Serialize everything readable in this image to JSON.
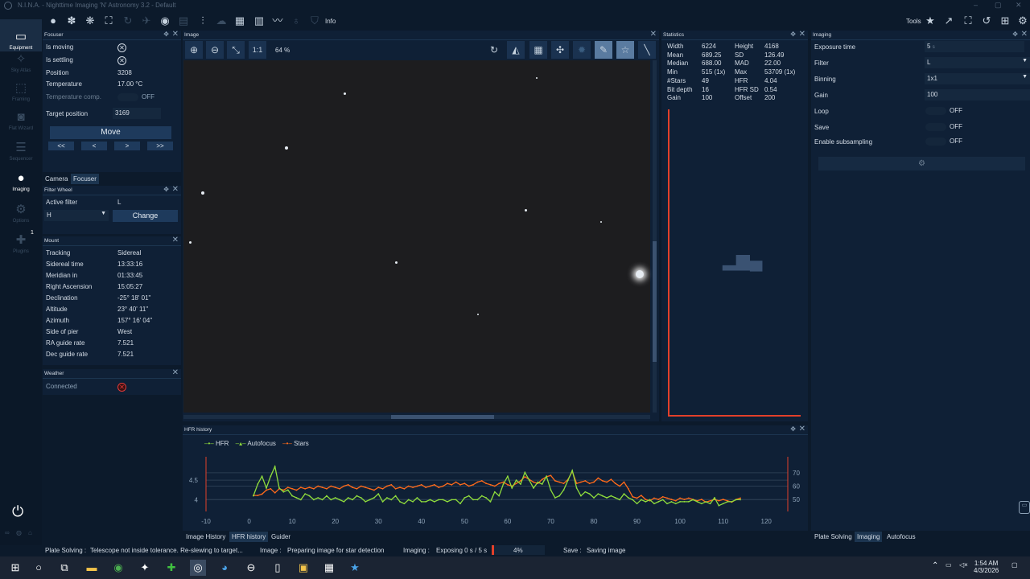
{
  "window": {
    "title": "N.I.N.A. - Nighttime Imaging 'N' Astronomy 3.2  -  Default"
  },
  "toolbar": {
    "info_label": "Info",
    "tools_label": "Tools"
  },
  "sidebar": {
    "items": [
      {
        "label": "Equipment",
        "icon": "equipment-icon"
      },
      {
        "label": "Sky Atlas",
        "icon": "sky-atlas-icon"
      },
      {
        "label": "Framing",
        "icon": "framing-icon"
      },
      {
        "label": "Flat Wizard",
        "icon": "flat-wizard-icon"
      },
      {
        "label": "Sequencer",
        "icon": "sequencer-icon"
      },
      {
        "label": "Imaging",
        "icon": "imaging-icon"
      },
      {
        "label": "Options",
        "icon": "options-icon"
      },
      {
        "label": "Plugins",
        "icon": "plugins-icon",
        "badge": "1"
      }
    ]
  },
  "focuser": {
    "title": "Focuser",
    "is_moving_label": "Is moving",
    "is_settling_label": "Is settling",
    "position_label": "Position",
    "position_value": "3208",
    "temperature_label": "Temperature",
    "temperature_value": "17.00 °C",
    "temp_comp_label": "Temperature comp.",
    "temp_comp_value": "OFF",
    "target_label": "Target position",
    "target_value": "3169",
    "move_label": "Move",
    "step_buttons": [
      "<<",
      "<",
      ">",
      ">>"
    ]
  },
  "camera_tabs": [
    "Camera",
    "Focuser"
  ],
  "filter_wheel": {
    "title": "Filter Wheel",
    "active_label": "Active filter",
    "active_value": "L",
    "select_value": "H",
    "change_label": "Change"
  },
  "mount": {
    "title": "Mount",
    "rows": [
      {
        "label": "Tracking",
        "value": "Sidereal"
      },
      {
        "label": "Sidereal time",
        "value": "13:33:16"
      },
      {
        "label": "Meridian in",
        "value": "01:33:45"
      },
      {
        "label": "Right Ascension",
        "value": "15:05:27"
      },
      {
        "label": "Declination",
        "value": "-25° 18' 01\""
      },
      {
        "label": "Altitude",
        "value": "23° 40' 11\""
      },
      {
        "label": "Azimuth",
        "value": "157° 16' 04\""
      },
      {
        "label": "Side of pier",
        "value": "West"
      },
      {
        "label": "RA guide rate",
        "value": "7.521"
      },
      {
        "label": "Dec guide rate",
        "value": "7.521"
      }
    ]
  },
  "weather": {
    "title": "Weather",
    "connected_label": "Connected"
  },
  "image": {
    "title": "Image",
    "zoom_text": "64 %",
    "one_to_one": "1:1"
  },
  "statistics": {
    "title": "Statistics",
    "left": [
      {
        "label": "Width",
        "value": "6224"
      },
      {
        "label": "Mean",
        "value": "689.25"
      },
      {
        "label": "Median",
        "value": "688.00"
      },
      {
        "label": "Min",
        "value": "515 (1x)"
      },
      {
        "label": "#Stars",
        "value": "49"
      },
      {
        "label": "Bit depth",
        "value": "16"
      },
      {
        "label": "Gain",
        "value": "100"
      }
    ],
    "right": [
      {
        "label": "Height",
        "value": "4168"
      },
      {
        "label": "SD",
        "value": "126.49"
      },
      {
        "label": "MAD",
        "value": "22.00"
      },
      {
        "label": "Max",
        "value": "53709 (1x)"
      },
      {
        "label": "HFR",
        "value": "4.04"
      },
      {
        "label": "HFR SD",
        "value": "0.54"
      },
      {
        "label": "Offset",
        "value": "200"
      }
    ]
  },
  "imaging": {
    "title": "Imaging",
    "rows": [
      {
        "label": "Exposure time",
        "value": "5",
        "unit": "s"
      },
      {
        "label": "Filter",
        "value": "L"
      },
      {
        "label": "Binning",
        "value": "1x1"
      },
      {
        "label": "Gain",
        "value": "100"
      }
    ],
    "toggles": [
      {
        "label": "Loop",
        "value": "OFF"
      },
      {
        "label": "Save",
        "value": "OFF"
      },
      {
        "label": "Enable subsampling",
        "value": "OFF"
      }
    ],
    "bottom_tabs": [
      "Plate Solving",
      "Imaging",
      "Autofocus"
    ]
  },
  "hfr_history": {
    "title": "HFR history",
    "legend": [
      {
        "name": "HFR",
        "color": "#8fdc3c"
      },
      {
        "name": "Autofocus",
        "color": "#8fdc3c"
      },
      {
        "name": "Stars",
        "color": "#ff6a1a"
      }
    ],
    "bottom_tabs": [
      "Image History",
      "HFR history",
      "Guider"
    ]
  },
  "chart_data": {
    "type": "line",
    "title": "",
    "xlabel": "",
    "ylabel": "",
    "x_ticks": [
      -10,
      0,
      10,
      20,
      30,
      40,
      50,
      60,
      70,
      80,
      90,
      100,
      110,
      120
    ],
    "xlim": [
      -10,
      125
    ],
    "y_left_ticks": [
      4,
      4.5
    ],
    "y_left_lim": [
      3.7,
      5.1
    ],
    "y_right_ticks": [
      50,
      60,
      70
    ],
    "y_right_lim": [
      41,
      82
    ],
    "series": [
      {
        "name": "HFR",
        "axis": "left",
        "color": "#8fdc3c",
        "x": [
          1,
          2,
          3,
          4,
          5,
          6,
          7,
          8,
          9,
          10,
          11,
          12,
          13,
          14,
          15,
          16,
          17,
          18,
          19,
          20,
          21,
          22,
          23,
          24,
          25,
          26,
          27,
          28,
          29,
          30,
          31,
          32,
          33,
          34,
          35,
          36,
          37,
          38,
          39,
          40,
          41,
          42,
          43,
          44,
          45,
          46,
          47,
          48,
          49,
          50,
          51,
          52,
          53,
          54,
          55,
          56,
          57,
          58,
          59,
          60,
          61,
          62,
          63,
          64,
          65,
          66,
          67,
          68,
          69,
          70,
          71,
          72,
          73,
          74,
          75,
          76,
          77,
          78,
          79,
          80,
          81,
          82,
          83,
          84,
          85,
          86,
          87,
          88,
          89,
          90,
          91,
          92,
          93,
          94,
          95,
          96,
          97,
          98,
          99,
          100,
          101,
          102,
          103,
          104,
          105,
          106,
          107,
          108,
          109,
          110,
          111,
          112,
          113,
          114
        ],
        "values": [
          4.1,
          4.4,
          4.6,
          4.3,
          4.6,
          4.85,
          4.3,
          4.2,
          4.25,
          4.1,
          4.05,
          4.0,
          4.15,
          4.1,
          4.0,
          4.05,
          4.0,
          4.1,
          4.0,
          4.05,
          4.0,
          3.95,
          4.05,
          4.0,
          4.1,
          4.05,
          3.95,
          4.0,
          4.05,
          4.15,
          3.95,
          4.05,
          4.0,
          4.1,
          3.95,
          3.9,
          4.0,
          3.95,
          4.05,
          3.95,
          3.95,
          4.0,
          3.95,
          4.0,
          4.0,
          3.95,
          4.0,
          4.0,
          3.9,
          4.05,
          4.1,
          4.0,
          4.0,
          4.1,
          4.05,
          3.95,
          4.2,
          4.1,
          4.4,
          4.6,
          4.3,
          4.5,
          4.4,
          4.7,
          4.5,
          4.3,
          4.45,
          4.4,
          4.6,
          4.25,
          4.05,
          4.1,
          4.25,
          4.5,
          4.75,
          4.3,
          4.1,
          4.2,
          4.15,
          4.05,
          4.15,
          4.1,
          4.05,
          4.1,
          4.05,
          4.0,
          4.15,
          4.05,
          4.0,
          3.9,
          4.0,
          3.95,
          4.0,
          3.9,
          3.95,
          4.0,
          3.9,
          3.95,
          3.9,
          3.95,
          3.95,
          3.95,
          4.0,
          3.95,
          3.9,
          3.95,
          3.9,
          4.05,
          3.85,
          3.9,
          3.95,
          3.95,
          4.0,
          4.0
        ]
      },
      {
        "name": "Stars",
        "axis": "right",
        "color": "#ff6a1a",
        "x": [
          1,
          2,
          3,
          4,
          5,
          6,
          7,
          8,
          9,
          10,
          11,
          12,
          13,
          14,
          15,
          16,
          17,
          18,
          19,
          20,
          21,
          22,
          23,
          24,
          25,
          26,
          27,
          28,
          29,
          30,
          31,
          32,
          33,
          34,
          35,
          36,
          37,
          38,
          39,
          40,
          41,
          42,
          43,
          44,
          45,
          46,
          47,
          48,
          49,
          50,
          51,
          52,
          53,
          54,
          55,
          56,
          57,
          58,
          59,
          60,
          61,
          62,
          63,
          64,
          65,
          66,
          67,
          68,
          69,
          70,
          71,
          72,
          73,
          74,
          75,
          76,
          77,
          78,
          79,
          80,
          81,
          82,
          83,
          84,
          85,
          86,
          87,
          88,
          89,
          90,
          91,
          92,
          93,
          94,
          95,
          96,
          97,
          98,
          99,
          100,
          101,
          102,
          103,
          104,
          105,
          106,
          107,
          108,
          109,
          110,
          111,
          112,
          113,
          114
        ],
        "values": [
          53,
          53,
          54,
          57,
          58,
          55,
          58,
          57,
          59,
          58,
          57,
          59,
          58,
          59,
          58,
          60,
          59,
          58,
          60,
          59,
          58,
          60,
          61,
          59,
          58,
          60,
          59,
          58,
          57,
          59,
          58,
          60,
          61,
          58,
          59,
          58,
          60,
          59,
          60,
          61,
          59,
          60,
          61,
          59,
          60,
          62,
          61,
          63,
          61,
          62,
          60,
          61,
          63,
          64,
          62,
          61,
          60,
          62,
          63,
          61,
          60,
          62,
          64,
          67,
          65,
          63,
          62,
          65,
          67,
          68,
          64,
          63,
          62,
          65,
          71,
          62,
          63,
          64,
          62,
          63,
          66,
          64,
          63,
          65,
          62,
          60,
          63,
          58,
          52,
          51,
          53,
          50,
          49,
          51,
          50,
          52,
          51,
          50,
          49,
          51,
          50,
          51,
          50,
          49,
          50,
          48,
          49,
          50,
          49,
          50,
          49,
          48,
          50,
          51
        ]
      }
    ]
  },
  "statusbar": {
    "plate_label": "Plate Solving :",
    "plate_text": "Telescope not inside tolerance. Re-slewing to target...",
    "image_label": "Image :",
    "image_text": "Preparing image for star detection",
    "imaging_label": "Imaging :",
    "imaging_text": "Exposing 0 s / 5 s",
    "progress_percent": 4,
    "progress_text": "4%",
    "save_label": "Save :",
    "save_text": "Saving image"
  },
  "taskbar": {
    "time": "1:54 AM",
    "date": "4/3/2026"
  }
}
